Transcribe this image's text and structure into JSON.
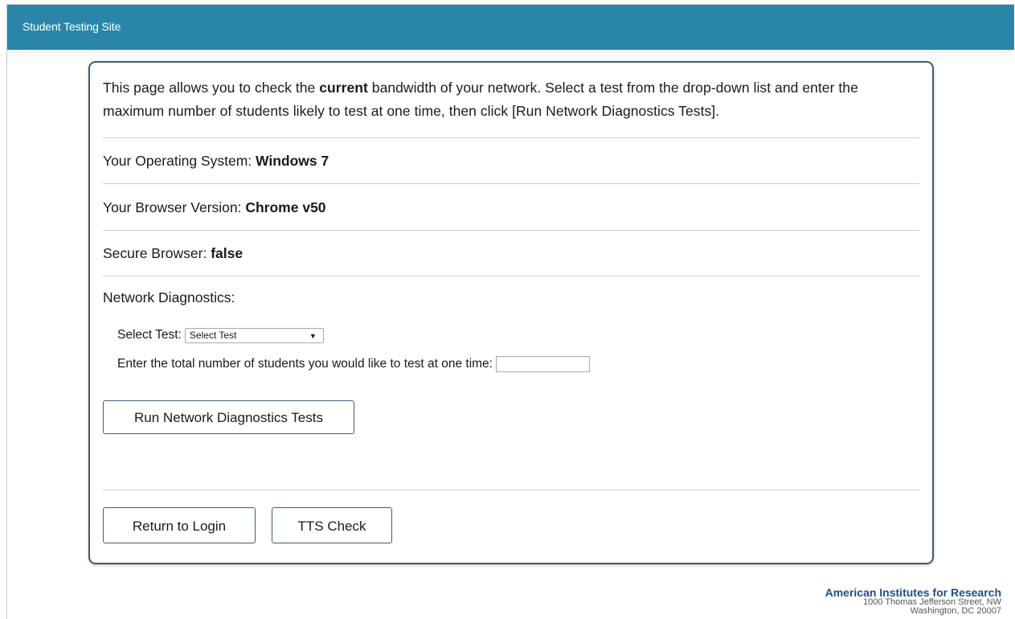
{
  "header": {
    "site_title": "Student Testing Site"
  },
  "intro": {
    "before": "This page allows you to check the ",
    "bold": "current",
    "after": " bandwidth of your network. Select a test from the drop-down list and enter the maximum number of students likely to test at one time, then click [Run Network Diagnostics Tests]."
  },
  "system": {
    "os_label": "Your Operating System: ",
    "os_value": "Windows 7",
    "browser_label": "Your Browser Version: ",
    "browser_value": "Chrome v50",
    "secure_label": "Secure Browser: ",
    "secure_value": "false"
  },
  "diagnostics": {
    "heading": "Network Diagnostics:",
    "select_label": "Select Test:",
    "select_value": "Select Test",
    "count_label": "Enter the total number of students you would like to test at one time:",
    "count_value": "",
    "run_button": "Run Network Diagnostics Tests"
  },
  "actions": {
    "return_button": "Return to Login",
    "tts_button": "TTS Check"
  },
  "footer": {
    "org_name": "American Institutes for Research",
    "address_line1": "1000 Thomas Jefferson Street, NW",
    "address_line2": "Washington, DC 20007"
  },
  "colors": {
    "header_bar": "#2a86a9",
    "panel_border": "#3d5f78",
    "org_name": "#1f4e87"
  },
  "icons": {
    "select_arrow": "dropdown-arrow-icon"
  }
}
